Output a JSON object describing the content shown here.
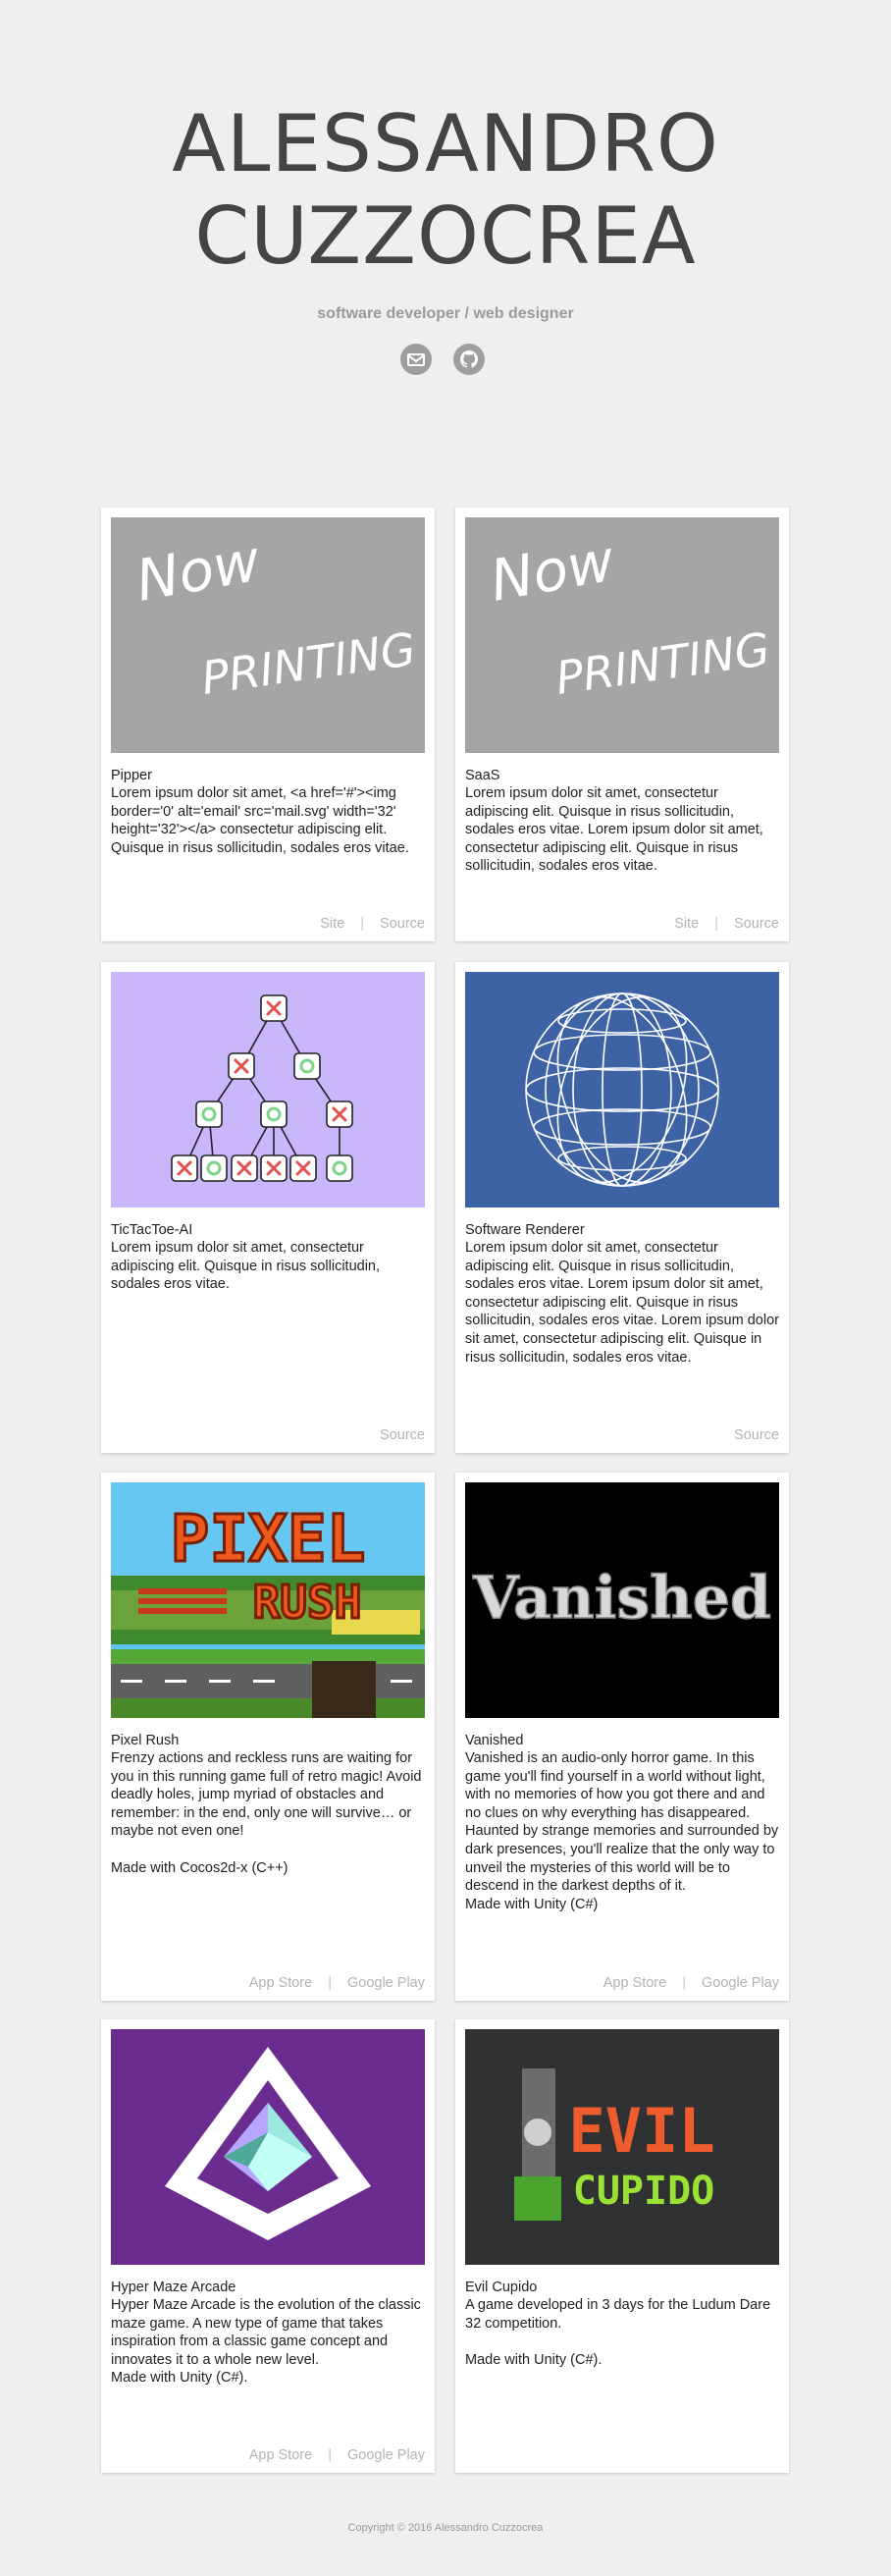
{
  "header": {
    "name_line1": "ALESSANDRO",
    "name_line2": "CUZZOCREA",
    "tagline": "software developer / web designer",
    "icons": [
      "mail-icon",
      "github-icon"
    ]
  },
  "placeholder": {
    "line1": "Now",
    "line2": "PRINTING"
  },
  "cards": [
    {
      "title": "Pipper",
      "desc": "Lorem ipsum dolor sit amet, <a href='#'><img border='0' alt='email' src='mail.svg' width='32' height='32'></a> consectetur adipiscing elit. Quisque in risus sollicitudin, sodales eros vitae.",
      "links": [
        "Site",
        "Source"
      ]
    },
    {
      "title": "SaaS",
      "desc": "Lorem ipsum dolor sit amet, consectetur adipiscing elit. Quisque in risus sollicitudin, sodales eros vitae. Lorem ipsum dolor sit amet, consectetur adipiscing elit. Quisque in risus sollicitudin, sodales eros vitae.",
      "links": [
        "Site",
        "Source"
      ]
    },
    {
      "title": "TicTacToe-AI",
      "desc": "Lorem ipsum dolor sit amet, consectetur adipiscing elit. Quisque in risus sollicitudin, sodales eros vitae.",
      "links": [
        "Source"
      ]
    },
    {
      "title": "Software Renderer",
      "desc": "Lorem ipsum dolor sit amet, consectetur adipiscing elit. Quisque in risus sollicitudin, sodales eros vitae. Lorem ipsum dolor sit amet, consectetur adipiscing elit. Quisque in risus sollicitudin, sodales eros vitae. Lorem ipsum dolor sit amet, consectetur adipiscing elit. Quisque in risus sollicitudin, sodales eros vitae.",
      "links": [
        "Source"
      ]
    },
    {
      "title": "Pixel Rush",
      "desc": "Frenzy actions and reckless runs are waiting for you in this running game full of retro magic! Avoid deadly holes, jump myriad of obstacles and remember: in the end, only one will survive… or maybe not even one!\n\nMade with Cocos2d-x (C++)",
      "links": [
        "App Store",
        "Google Play"
      ],
      "art_text": [
        "PIXEL",
        "RUSH"
      ]
    },
    {
      "title": "Vanished",
      "desc": "Vanished is an audio-only horror game. In this game you'll find yourself in a world without light, with no memories of how you got there and and no clues on why everything has disappeared. Haunted by strange memories and surrounded by dark presences, you'll realize that the only way to unveil the mysteries of this world will be to descend in the darkest depths of it.\nMade with Unity (C#)",
      "links": [
        "App Store",
        "Google Play"
      ],
      "art_text": [
        "Vanished"
      ]
    },
    {
      "title": "Hyper Maze Arcade",
      "desc": "Hyper Maze Arcade is the evolution of the classic maze game. A new type of game that takes inspiration from a classic game concept and innovates it to a whole new level.\nMade with Unity (C#).",
      "links": [
        "App Store",
        "Google Play"
      ]
    },
    {
      "title": "Evil Cupido",
      "desc": "A game developed in 3 days for the Ludum Dare 32 competition.\n\nMade with Unity (C#).",
      "links": [],
      "art_text": [
        "EVIL",
        "CUPIDO"
      ]
    }
  ],
  "colors": {
    "background": "#efefef",
    "placeholder": "#a5a5a5",
    "tictactoe": "#c9b6fb",
    "renderer": "#3d63a5",
    "vanished": "#000000",
    "hypermaze": "#6a2c8f",
    "evilcupido": "#2f3133"
  },
  "footer": "Copyright © 2016 Alessandro Cuzzocrea"
}
